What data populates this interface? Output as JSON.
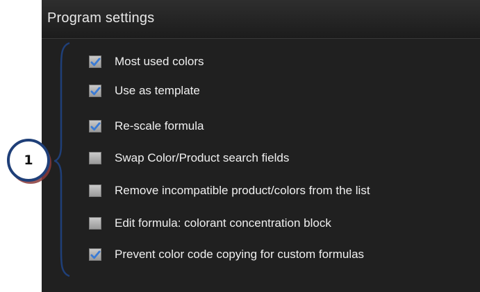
{
  "panel": {
    "title": "Program settings"
  },
  "callout": {
    "number": "1",
    "color": "#1f3f78"
  },
  "options": [
    {
      "label": "Most used colors",
      "checked": true
    },
    {
      "label": "Use as template",
      "checked": true
    },
    {
      "label": "Re-scale formula",
      "checked": true
    },
    {
      "label": "Swap Color/Product search fields",
      "checked": false
    },
    {
      "label": "Remove incompatible product/colors from the list",
      "checked": false
    },
    {
      "label": "Edit formula: colorant concentration block",
      "checked": false
    },
    {
      "label": "Prevent color code copying for custom formulas",
      "checked": true
    }
  ],
  "colors": {
    "check_mark": "#3a7bd5",
    "panel_background": "#202020",
    "bracket": "#1f3f78"
  }
}
